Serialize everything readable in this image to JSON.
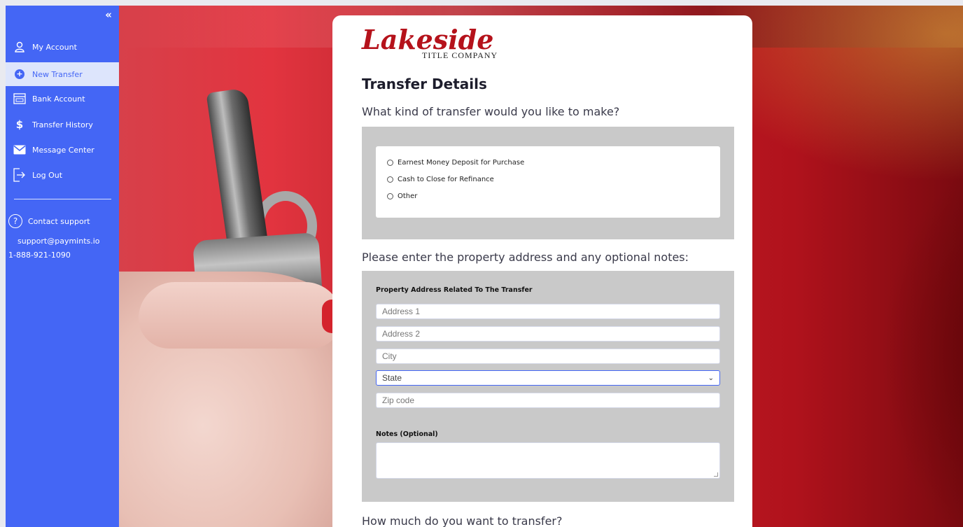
{
  "sidebar": {
    "collapse_icon": "«",
    "items": [
      {
        "label": "My Account",
        "icon": "user-icon"
      },
      {
        "label": "New Transfer",
        "icon": "plus-circle-icon",
        "active": true
      },
      {
        "label": "Bank Account",
        "icon": "bank-icon"
      },
      {
        "label": "Transfer History",
        "icon": "dollar-icon"
      },
      {
        "label": "Message Center",
        "icon": "envelope-icon"
      },
      {
        "label": "Log Out",
        "icon": "logout-icon"
      }
    ],
    "support": {
      "label": "Contact support",
      "email": "support@paymints.io",
      "phone": "1-888-921-1090"
    },
    "color": "#4466f5"
  },
  "logo": {
    "main": "Lakeside",
    "sub": "TITLE COMPANY"
  },
  "form": {
    "title": "Transfer Details",
    "q1": "What kind of transfer would you like to make?",
    "transfer_options": [
      "Earnest Money Deposit for Purchase",
      "Cash to Close for Refinance",
      "Other"
    ],
    "q2": "Please enter the property address and any optional notes:",
    "address_label": "Property Address Related To The Transfer",
    "placeholders": {
      "address1": "Address 1",
      "address2": "Address 2",
      "city": "City",
      "state": "State",
      "zip": "Zip code"
    },
    "notes_label": "Notes (Optional)",
    "q3": "How much do you want to transfer?"
  }
}
